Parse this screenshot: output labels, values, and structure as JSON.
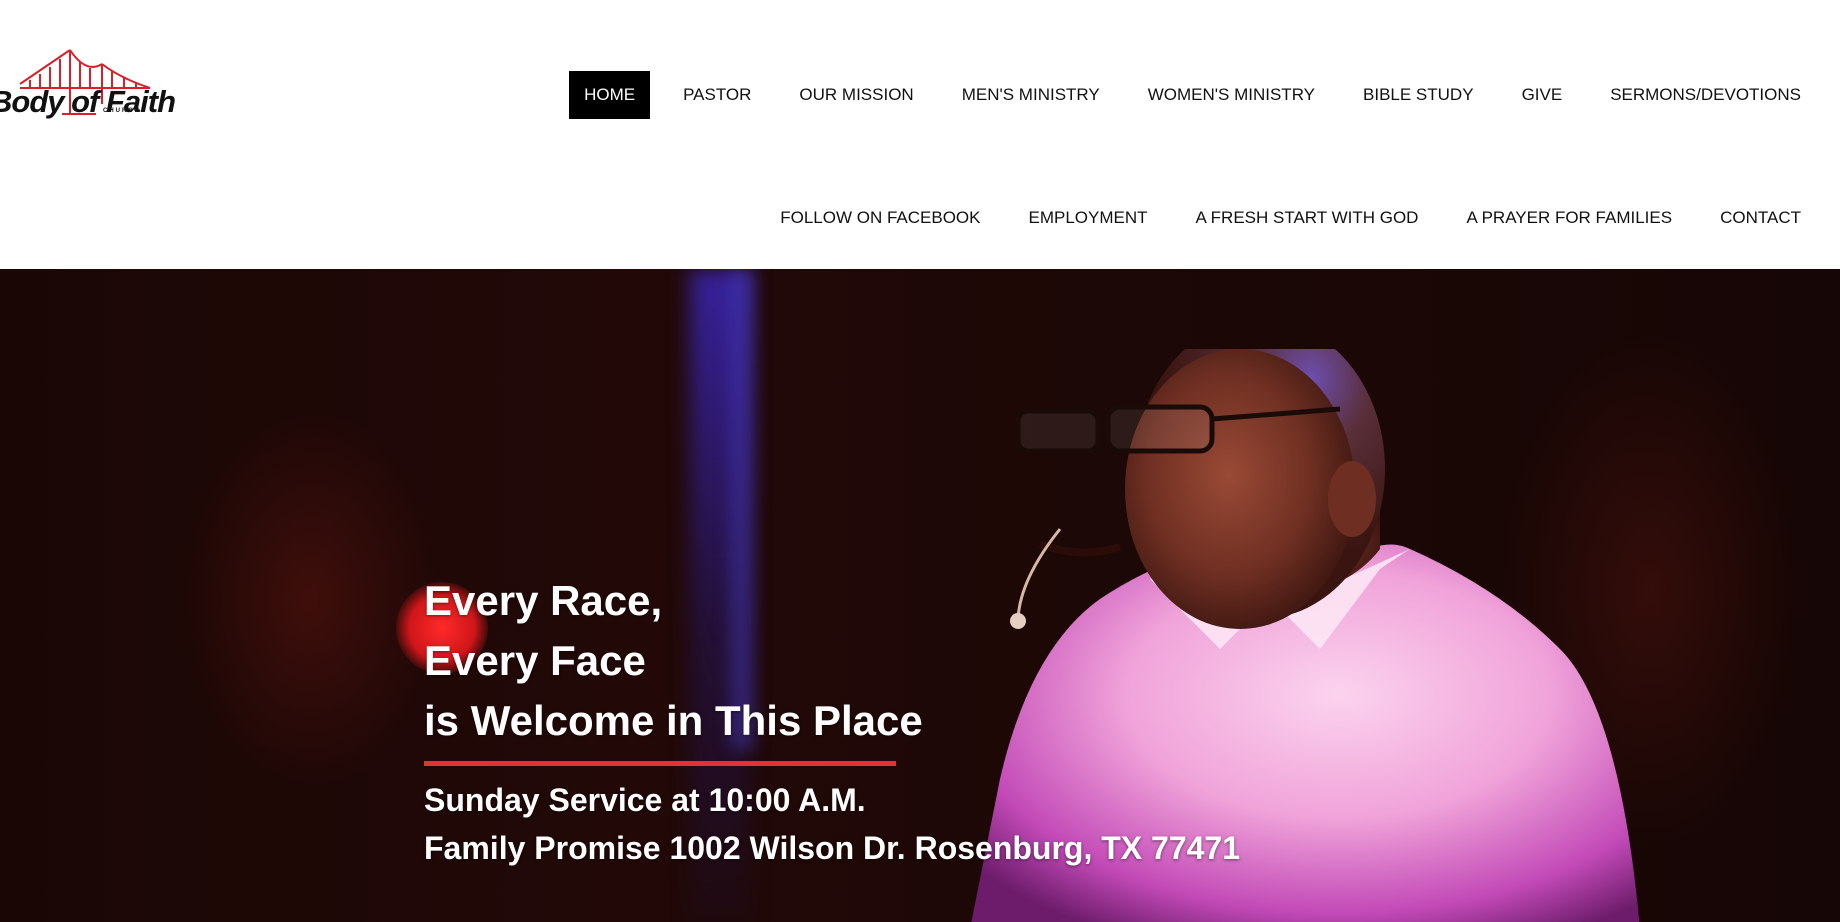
{
  "brand": {
    "logo_text": "Body of Faith",
    "logo_subtext": "CHURCH",
    "accent_color": "#e0342e"
  },
  "nav": {
    "row1": [
      {
        "label": "HOME",
        "active": true
      },
      {
        "label": "PASTOR"
      },
      {
        "label": "OUR MISSION"
      },
      {
        "label": "MEN'S MINISTRY"
      },
      {
        "label": "WOMEN'S MINISTRY"
      },
      {
        "label": "BIBLE STUDY"
      },
      {
        "label": "GIVE"
      },
      {
        "label": "SERMONS/DEVOTIONS"
      }
    ],
    "row2": [
      {
        "label": "FOLLOW ON FACEBOOK"
      },
      {
        "label": "EMPLOYMENT"
      },
      {
        "label": "A FRESH START WITH GOD"
      },
      {
        "label": "A PRAYER FOR FAMILIES"
      },
      {
        "label": "CONTACT"
      }
    ]
  },
  "hero": {
    "headline": [
      "Every Race,",
      "Every Face",
      "is Welcome in This Place"
    ],
    "service_time": "Sunday Service at 10:00 A.M.",
    "address": "Family Promise 1002 Wilson Dr. Rosenburg, TX 77471"
  }
}
